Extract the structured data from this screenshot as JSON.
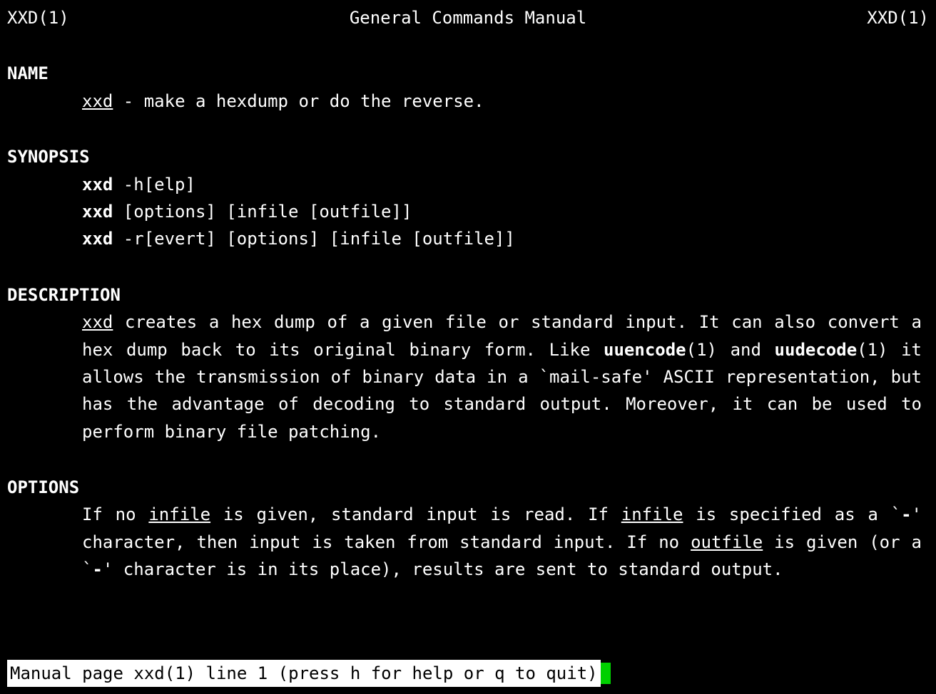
{
  "header": {
    "left": "XXD(1)",
    "center": "General Commands Manual",
    "right": "XXD(1)"
  },
  "name": {
    "heading": "NAME",
    "cmd": "xxd",
    "sep": " - ",
    "desc": "make a hexdump or do the reverse."
  },
  "synopsis": {
    "heading": "SYNOPSIS",
    "lines": [
      {
        "cmd": "xxd",
        "rest": " -h[elp]"
      },
      {
        "cmd": "xxd",
        "rest": " [options] [infile [outfile]]"
      },
      {
        "cmd": "xxd",
        "rest": " -r[evert] [options] [infile [outfile]]"
      }
    ]
  },
  "description": {
    "heading": "DESCRIPTION",
    "p1_a": "xxd",
    "p1_b": "  creates a hex dump of a given file or standard input.  It can also convert a hex dump back to its original binary form.  Like  ",
    "p1_c": "uuencode",
    "p1_d": "(1) and  ",
    "p1_e": "uudecode",
    "p1_f": "(1)  it allows the transmission of binary data in a `mail-safe' ASCII representation, but has the advantage of decoding to  standard output.  Moreover, it can be used to perform binary file patching."
  },
  "options": {
    "heading": "OPTIONS",
    "p1_a": "If  no ",
    "p1_b": "infile",
    "p1_c": " is given, standard input is read.  If ",
    "p1_d": "infile",
    "p1_e": " is specified as a `",
    "p1_f": "-",
    "p1_g": "' character, then input is taken from  standard  input.   If  no ",
    "p1_h": "outfile",
    "p1_i": " is given (or a `",
    "p1_j": "-",
    "p1_k": "' character is in its place), results are sent to standard output."
  },
  "status": {
    "text": " Manual page xxd(1) line 1 (press h for help or q to quit)"
  }
}
